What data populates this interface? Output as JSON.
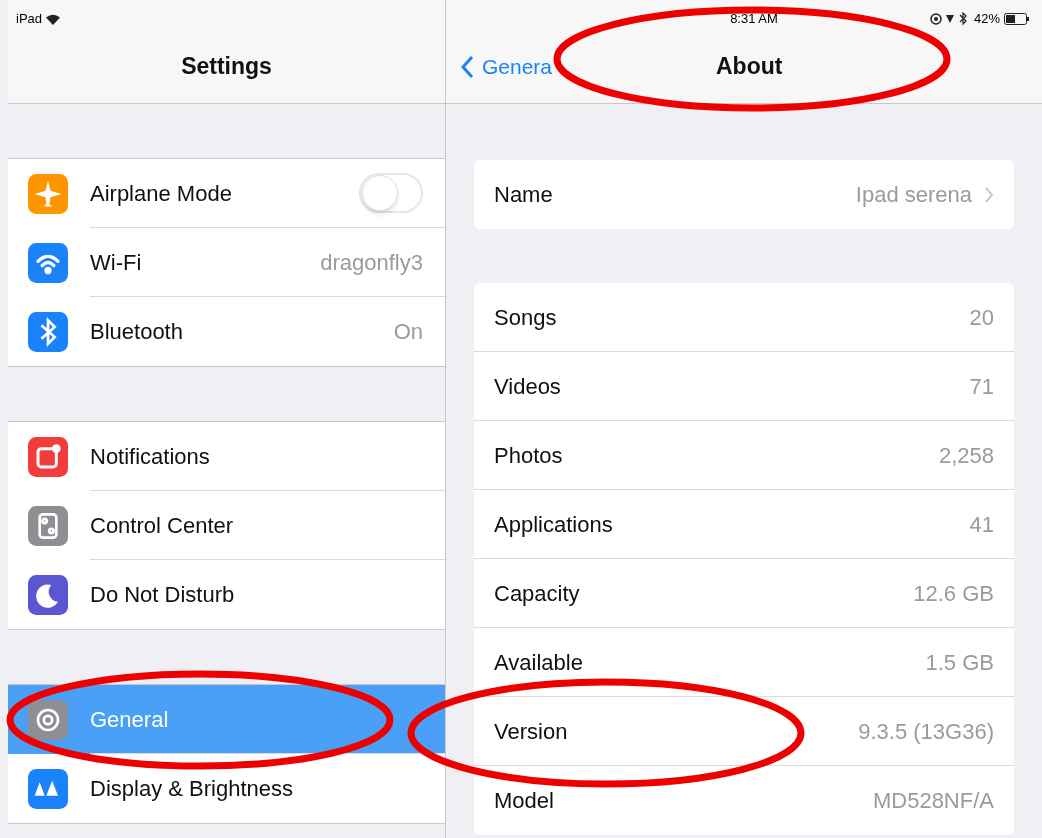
{
  "status_bar": {
    "device": "iPad",
    "time": "8:31 AM",
    "battery": "42%"
  },
  "sidebar": {
    "title": "Settings",
    "groups": [
      [
        {
          "label": "Airplane Mode",
          "kind": "toggle",
          "on": false,
          "selected": false,
          "color": "#ff9500"
        },
        {
          "label": "Wi-Fi",
          "kind": "value",
          "value": "dragonfly3",
          "selected": false,
          "color": "#1a82fb"
        },
        {
          "label": "Bluetooth",
          "kind": "value",
          "value": "On",
          "selected": false,
          "color": "#1a82fb"
        }
      ],
      [
        {
          "label": "Notifications",
          "kind": "plain",
          "selected": false,
          "color": "#f23c3c"
        },
        {
          "label": "Control Center",
          "kind": "plain",
          "selected": false,
          "color": "#8e8e93"
        },
        {
          "label": "Do Not Disturb",
          "kind": "plain",
          "selected": false,
          "color": "#5b57d0"
        }
      ],
      [
        {
          "label": "General",
          "kind": "plain",
          "selected": true,
          "color": "#8e8e93"
        },
        {
          "label": "Display & Brightness",
          "kind": "plain",
          "selected": false,
          "color": "#1a82fb"
        }
      ]
    ]
  },
  "detail": {
    "back": "Genera",
    "title": "About",
    "sections": [
      [
        {
          "label": "Name",
          "value": "Ipad serena",
          "kind": "link"
        }
      ],
      [
        {
          "label": "Songs",
          "value": "20",
          "kind": "info"
        },
        {
          "label": "Videos",
          "value": "71",
          "kind": "info"
        },
        {
          "label": "Photos",
          "value": "2,258",
          "kind": "info"
        },
        {
          "label": "Applications",
          "value": "41",
          "kind": "info"
        },
        {
          "label": "Capacity",
          "value": "12.6 GB",
          "kind": "info"
        },
        {
          "label": "Available",
          "value": "1.5 GB",
          "kind": "info"
        },
        {
          "label": "Version",
          "value": "9.3.5 (13G36)",
          "kind": "info"
        },
        {
          "label": "Model",
          "value": "MD528NF/A",
          "kind": "info"
        }
      ]
    ]
  },
  "annotations": [
    {
      "kind": "ellipse"
    },
    {
      "kind": "ellipse"
    },
    {
      "kind": "ellipse"
    }
  ]
}
